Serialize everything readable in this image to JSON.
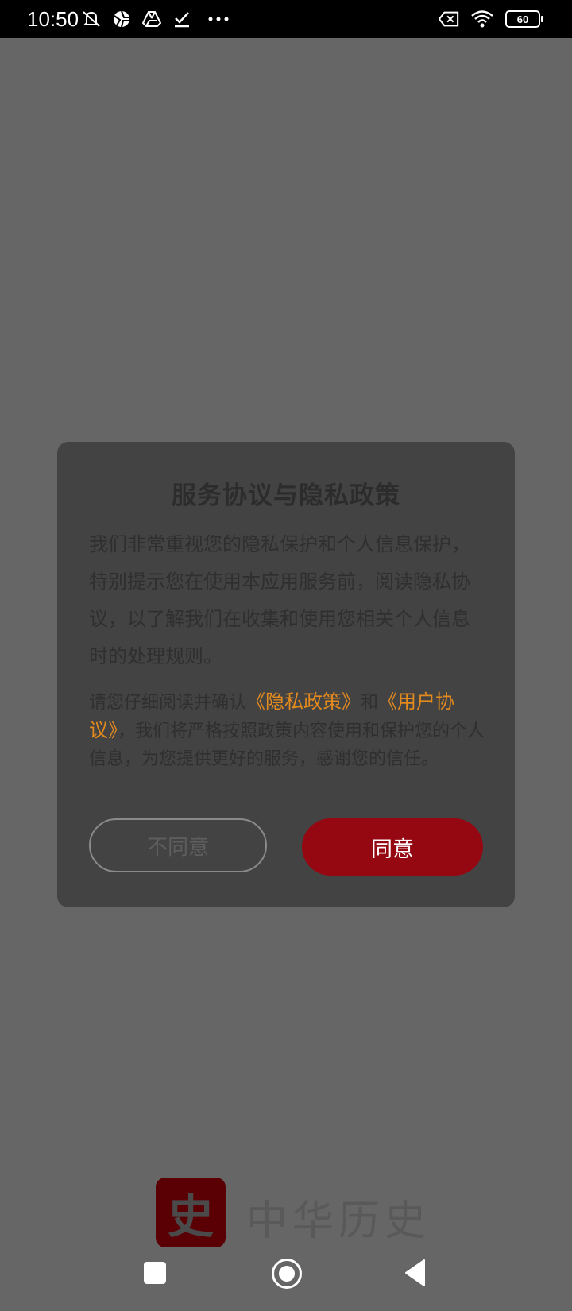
{
  "status_bar": {
    "time": "10:50",
    "battery": "60",
    "icons_left": [
      "mute-icon",
      "camera-aperture-icon",
      "drive-icon",
      "check-download-icon",
      "more-dots-icon"
    ],
    "icons_right": [
      "no-sim-icon",
      "wifi-icon",
      "battery-icon"
    ]
  },
  "dialog": {
    "title": "服务协议与隐私政策",
    "intro": "我们非常重视您的隐私保护和个人信息保护，特别提示您在使用本应用服务前，阅读隐私协议，以了解我们在收集和使用您相关个人信息时的处理规则。",
    "confirm_prefix": "请您仔细阅读并确认",
    "privacy_link": "《隐私政策》",
    "connector": "和",
    "user_link": "《用户协议》",
    "confirm_suffix": "，我们将严格按照政策内容使用和保护您的个人信息，为您提供更好的服务，感谢您的信任。",
    "disagree_label": "不同意",
    "agree_label": "同意"
  },
  "brand": {
    "logo_char": "史",
    "name": "中华历史"
  },
  "colors": {
    "overlay": "#666666",
    "dialog_bg": "#434343",
    "accent_red": "#950711",
    "link_orange": "#e38a1e"
  }
}
